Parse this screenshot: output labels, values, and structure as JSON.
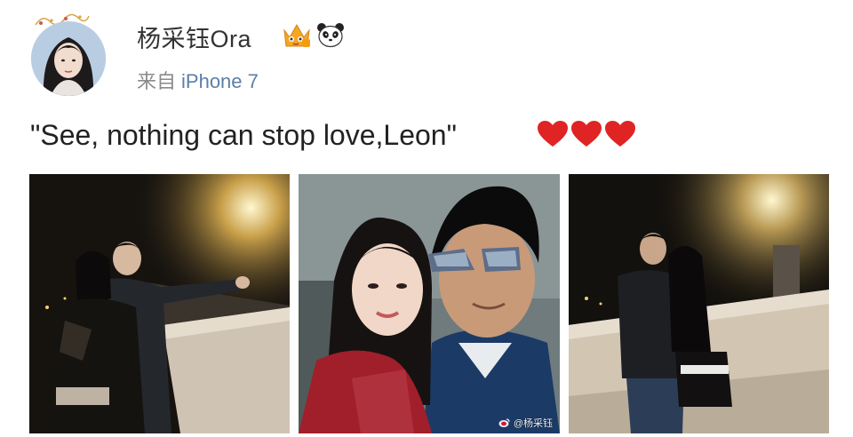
{
  "header": {
    "username": "杨采钰Ora",
    "source_prefix": "来自",
    "source_device": "iPhone 7",
    "avatar_icon": "avatar",
    "badges": [
      "crown-vip-icon",
      "panda-icon"
    ]
  },
  "post": {
    "text": "\"See, nothing can stop love,Leon\"",
    "hearts_icon": "red-hearts-icon",
    "heart_count": 3
  },
  "photos": [
    {
      "watermark": ""
    },
    {
      "watermark": "@杨采钰"
    },
    {
      "watermark": ""
    }
  ],
  "colors": {
    "username": "#333333",
    "source": "#8a8a8a",
    "device": "#5a7fa8",
    "heart": "#e02424"
  }
}
